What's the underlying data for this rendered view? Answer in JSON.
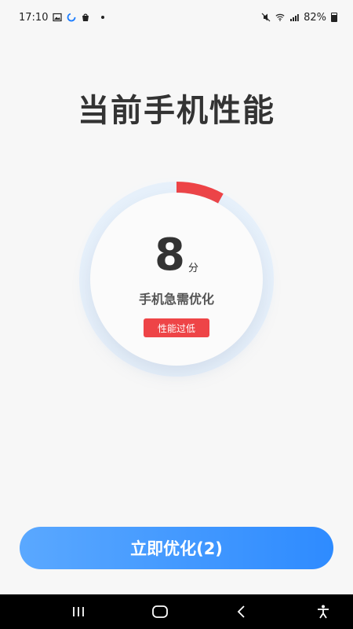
{
  "status_bar": {
    "time": "17:10",
    "battery": "82%",
    "icons": [
      "image-icon",
      "loading-icon",
      "bag-icon",
      "dot-icon",
      "mute-icon",
      "wifi-icon",
      "signal-icon",
      "battery-icon"
    ]
  },
  "main": {
    "title": "当前手机性能",
    "score": "8",
    "score_unit": "分",
    "status": "手机急需优化",
    "badge": "性能过低",
    "score_fraction": 0.08
  },
  "actions": {
    "optimize_label": "立即优化(2)"
  },
  "nav_bar": {
    "icons": [
      "recent-apps-icon",
      "home-icon",
      "back-icon",
      "accessibility-icon"
    ]
  },
  "colors": {
    "accent_red": "#ee4447",
    "button_blue_start": "#5aa8ff",
    "button_blue_end": "#2e8bff",
    "text_dark": "#333333"
  }
}
